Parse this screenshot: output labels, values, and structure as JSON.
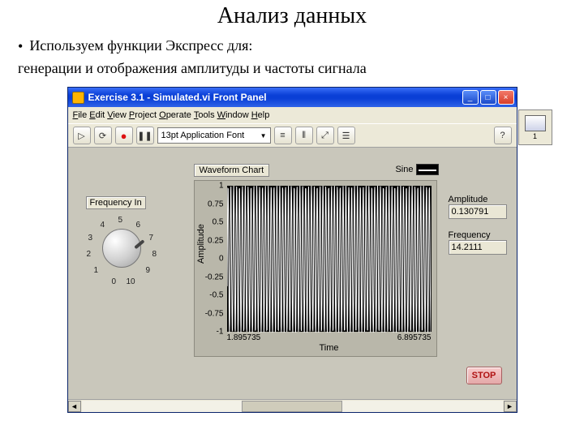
{
  "slide": {
    "title": "Анализ данных",
    "bullet": "Используем функции Экспресс для:",
    "sub": "генерации и отображения амплитуды и частоты сигнала"
  },
  "window": {
    "title": "Exercise 3.1 - Simulated.vi Front Panel",
    "min": "_",
    "max": "□",
    "close": "×"
  },
  "menu": {
    "file": "File",
    "edit": "Edit",
    "view": "View",
    "project": "Project",
    "operate": "Operate",
    "tools": "Tools",
    "window": "Window",
    "help": "Help"
  },
  "toolbar": {
    "run": "▷",
    "run_cont": "⟳",
    "record": "●",
    "pause": "❚❚",
    "font": "13pt Application Font",
    "caret": "▼",
    "align": "≡",
    "distribute": "⫴",
    "resize": "⤢",
    "reorder": "☰",
    "help": "?",
    "ctx_num": "1"
  },
  "knob": {
    "label": "Frequency In",
    "ticks": [
      "0",
      "1",
      "2",
      "3",
      "4",
      "5",
      "6",
      "7",
      "8",
      "9",
      "10"
    ]
  },
  "chart_data": {
    "type": "line",
    "title": "Waveform Chart",
    "legend": "Sine",
    "xlabel": "Time",
    "ylabel": "Amplitude",
    "xlim": [
      1.895735,
      6.895735
    ],
    "ylim": [
      -1,
      1
    ],
    "yticks": [
      "1",
      "0.75",
      "0.5",
      "0.25",
      "0",
      "-0.25",
      "-0.5",
      "-0.75",
      "-1"
    ],
    "xticks": [
      "1.895735",
      "6.895735"
    ],
    "series": [
      {
        "name": "Sine",
        "amplitude": 1,
        "frequency_hz": 14.2111,
        "phase": 0
      }
    ]
  },
  "readouts": {
    "amp_label": "Amplitude",
    "amp_value": "0.130791",
    "freq_label": "Frequency",
    "freq_value": "14.2111"
  },
  "icons": {
    "stop": "STOP",
    "sb_left": "◄",
    "sb_right": "►"
  }
}
